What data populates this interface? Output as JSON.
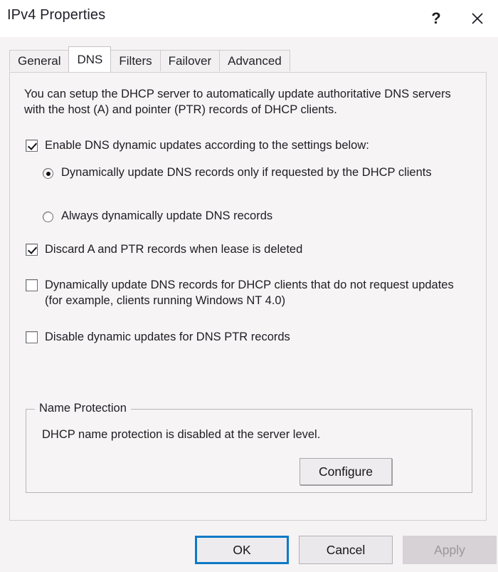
{
  "window": {
    "title": "IPv4 Properties",
    "help_icon": "question-mark-icon",
    "close_icon": "close-icon"
  },
  "tabs": [
    {
      "label": "General",
      "selected": false
    },
    {
      "label": "DNS",
      "selected": true
    },
    {
      "label": "Filters",
      "selected": false
    },
    {
      "label": "Failover",
      "selected": false
    },
    {
      "label": "Advanced",
      "selected": false
    }
  ],
  "panel": {
    "intro": "You can setup the DHCP server to automatically update authoritative DNS servers with the host (A) and pointer (PTR) records of DHCP clients.",
    "enable_updates": {
      "label": "Enable DNS dynamic updates according to the settings below:",
      "checked": true
    },
    "radio_options": [
      {
        "label": "Dynamically update DNS records only if requested by the DHCP clients",
        "selected": true
      },
      {
        "label": "Always dynamically update DNS records",
        "selected": false
      }
    ],
    "checkboxes": [
      {
        "label": "Discard A and PTR records when lease is deleted",
        "checked": true
      },
      {
        "label": "Dynamically update DNS records for DHCP clients that do not request updates (for example, clients running Windows NT 4.0)",
        "checked": false
      },
      {
        "label": "Disable dynamic updates for DNS PTR records",
        "checked": false
      }
    ],
    "name_protection": {
      "title": "Name Protection",
      "status_text": "DHCP name protection is disabled at the server level.",
      "configure_label": "Configure"
    }
  },
  "footer": {
    "ok_label": "OK",
    "cancel_label": "Cancel",
    "apply_label": "Apply",
    "apply_enabled": false,
    "accent_color": "#0d7ac6"
  }
}
